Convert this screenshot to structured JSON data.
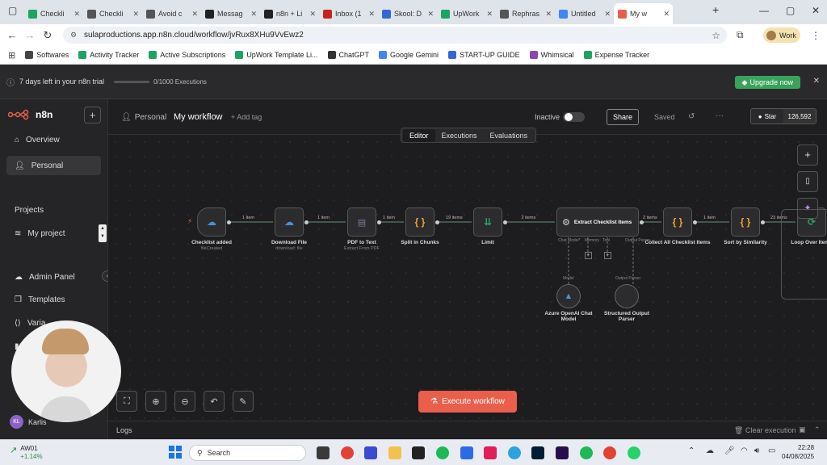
{
  "browser": {
    "tabs": [
      {
        "label": "Checkli",
        "color": "#1ea362"
      },
      {
        "label": "Checkli",
        "color": "#555"
      },
      {
        "label": "Avoid c",
        "color": "#555"
      },
      {
        "label": "Messag",
        "color": "#222"
      },
      {
        "label": "n8n + Li",
        "color": "#222"
      },
      {
        "label": "Inbox (1",
        "color": "#c5221f"
      },
      {
        "label": "Skool: D",
        "color": "#3367d6"
      },
      {
        "label": "UpWork",
        "color": "#1ea362"
      },
      {
        "label": "Rephras",
        "color": "#555"
      },
      {
        "label": "Untitled",
        "color": "#4285f4"
      },
      {
        "label": "My w",
        "color": "#ea5f4c"
      }
    ],
    "new_tab_icon": "plus-icon",
    "url": "sulaproductions.app.n8n.cloud/workflow/jvRux8XHu9VvEwz2",
    "profile": "Work",
    "bookmarks": [
      "Softwares",
      "Activity Tracker",
      "Active Subscriptions",
      "UpWork Template Li...",
      "ChatGPT",
      "Google Gemini",
      "START-UP GUIDE",
      "Whimsical",
      "Expense Tracker"
    ]
  },
  "trial": {
    "text": "7 days left in your n8n trial",
    "executions": "0/1000 Executions",
    "upgrade": "Upgrade now"
  },
  "sidebar": {
    "logo": "n8n",
    "items": [
      "Overview",
      "Personal"
    ],
    "projects_heading": "Projects",
    "project": "My project",
    "bottom_items": [
      "Admin Panel",
      "Templates",
      "Varia",
      "l"
    ],
    "user_initials": "KL",
    "user_name": "Karlis"
  },
  "header": {
    "breadcrumb": "Personal",
    "workflow_name": "My workflow",
    "add_tag": "+ Add tag",
    "status": "Inactive",
    "share": "Share",
    "saved": "Saved",
    "star": "Star",
    "star_count": "126,592",
    "tabs": [
      "Editor",
      "Executions",
      "Evaluations"
    ]
  },
  "nodes": [
    {
      "title": "Checklist added",
      "sub": "fileCreated"
    },
    {
      "title": "Download File",
      "sub": "download: file"
    },
    {
      "title": "PDF to Text",
      "sub": "Extract From PDF"
    },
    {
      "title": "Split in Chunks",
      "sub": ""
    },
    {
      "title": "Limit",
      "sub": ""
    },
    {
      "title": "Extract Checklist Items",
      "sub": ""
    },
    {
      "title": "Collect All Checklist Items",
      "sub": ""
    },
    {
      "title": "Sort by Similarity",
      "sub": ""
    },
    {
      "title": "Loop Over Items",
      "sub": ""
    }
  ],
  "edges": [
    "1 item",
    "1 item",
    "1 item",
    "19 items",
    "2 items",
    "2 items",
    "1 item",
    "23 items"
  ],
  "agent_ports": [
    "Chat Model*",
    "Memory",
    "Tool",
    "Output Parser"
  ],
  "sub_nodes": [
    {
      "title": "Azure OpenAI Chat Model",
      "port": "Model"
    },
    {
      "title": "Structured Output Parser",
      "port": "Output Parser"
    }
  ],
  "execute": "Execute workflow",
  "logs": {
    "label": "Logs",
    "clear": "Clear execution"
  },
  "taskbar": {
    "stock": "AW01",
    "stock_change": "+1.14%",
    "search": "Search",
    "time": "22:28",
    "date": "04/08/2025"
  },
  "colors": {
    "accent": "#ea5f4c",
    "green": "#3aa35b"
  }
}
